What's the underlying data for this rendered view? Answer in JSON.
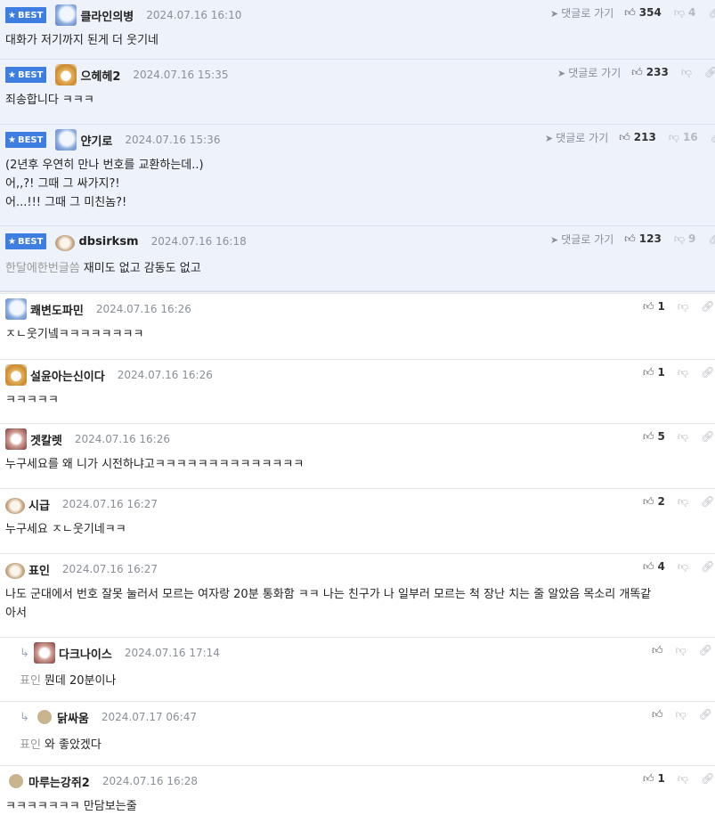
{
  "labels": {
    "best": "BEST",
    "goto": "댓글로 가기"
  },
  "comments": [
    {
      "best": true,
      "nick": "클라인의병",
      "date": "2024.07.16 16:10",
      "likes": "354",
      "dislikes": "4",
      "lines": [
        "대화가 저기까지 된게 더 웃기네"
      ]
    },
    {
      "best": true,
      "nick": "으헤헤2",
      "date": "2024.07.16 15:35",
      "likes": "233",
      "dislikes": "",
      "lines": [
        "죄송합니다 ㅋㅋㅋ"
      ]
    },
    {
      "best": true,
      "nick": "얀기로",
      "date": "2024.07.16 15:36",
      "likes": "213",
      "dislikes": "16",
      "lines": [
        "(2년후 우연히 만나 번호를 교환하는데..)",
        "어,,?! 그때 그 싸가지?!",
        "어...!!! 그때 그 미친놈?!"
      ]
    },
    {
      "best": true,
      "nick": "dbsirksm",
      "date": "2024.07.16 16:18",
      "likes": "123",
      "dislikes": "9",
      "mention": "한달에한번글씀",
      "lines": [
        "재미도 없고 감동도 없고"
      ]
    },
    {
      "nick": "쾌변도파민",
      "date": "2024.07.16 16:26",
      "likes": "1",
      "lines": [
        "ㅈㄴ웃기넼ㅋㅋㅋㅋㅋㅋㅋㅋ"
      ]
    },
    {
      "nick": "설윤아는신이다",
      "date": "2024.07.16 16:26",
      "likes": "1",
      "lines": [
        "ㅋㅋㅋㅋㅋ"
      ]
    },
    {
      "nick": "겟칼렛",
      "date": "2024.07.16 16:26",
      "likes": "5",
      "lines": [
        "누구세요를 왜 니가 시전하냐고ㅋㅋㅋㅋㅋㅋㅋㅋㅋㅋㅋㅋㅋㅋ"
      ]
    },
    {
      "nick": "시급",
      "date": "2024.07.16 16:27",
      "likes": "2",
      "lines": [
        "누구세요 ㅈㄴ웃기네ㅋㅋ"
      ]
    },
    {
      "nick": "표인",
      "date": "2024.07.16 16:27",
      "likes": "4",
      "lines": [
        "나도 군대에서 번호 잘못 눌러서 모르는 여자랑 20분 통화함 ㅋㅋ 나는 친구가 나 일부러 모르는 척 장난 치는 줄 알았음 목소리 개똑같",
        "아서"
      ]
    },
    {
      "reply": true,
      "nick": "다크나이스",
      "date": "2024.07.16 17:14",
      "likes": "",
      "mention": "표인",
      "lines": [
        "뭔데 20분이나"
      ]
    },
    {
      "reply": true,
      "nick": "닭싸움",
      "date": "2024.07.17 06:47",
      "likes": "",
      "mention": "표인",
      "lines": [
        "와 좋았겠다"
      ]
    },
    {
      "nick": "마루는강쥐2",
      "date": "2024.07.16 16:28",
      "likes": "1",
      "lines": [
        "ㅋㅋㅋㅋㅋㅋㅋ 만담보는줄"
      ]
    }
  ]
}
